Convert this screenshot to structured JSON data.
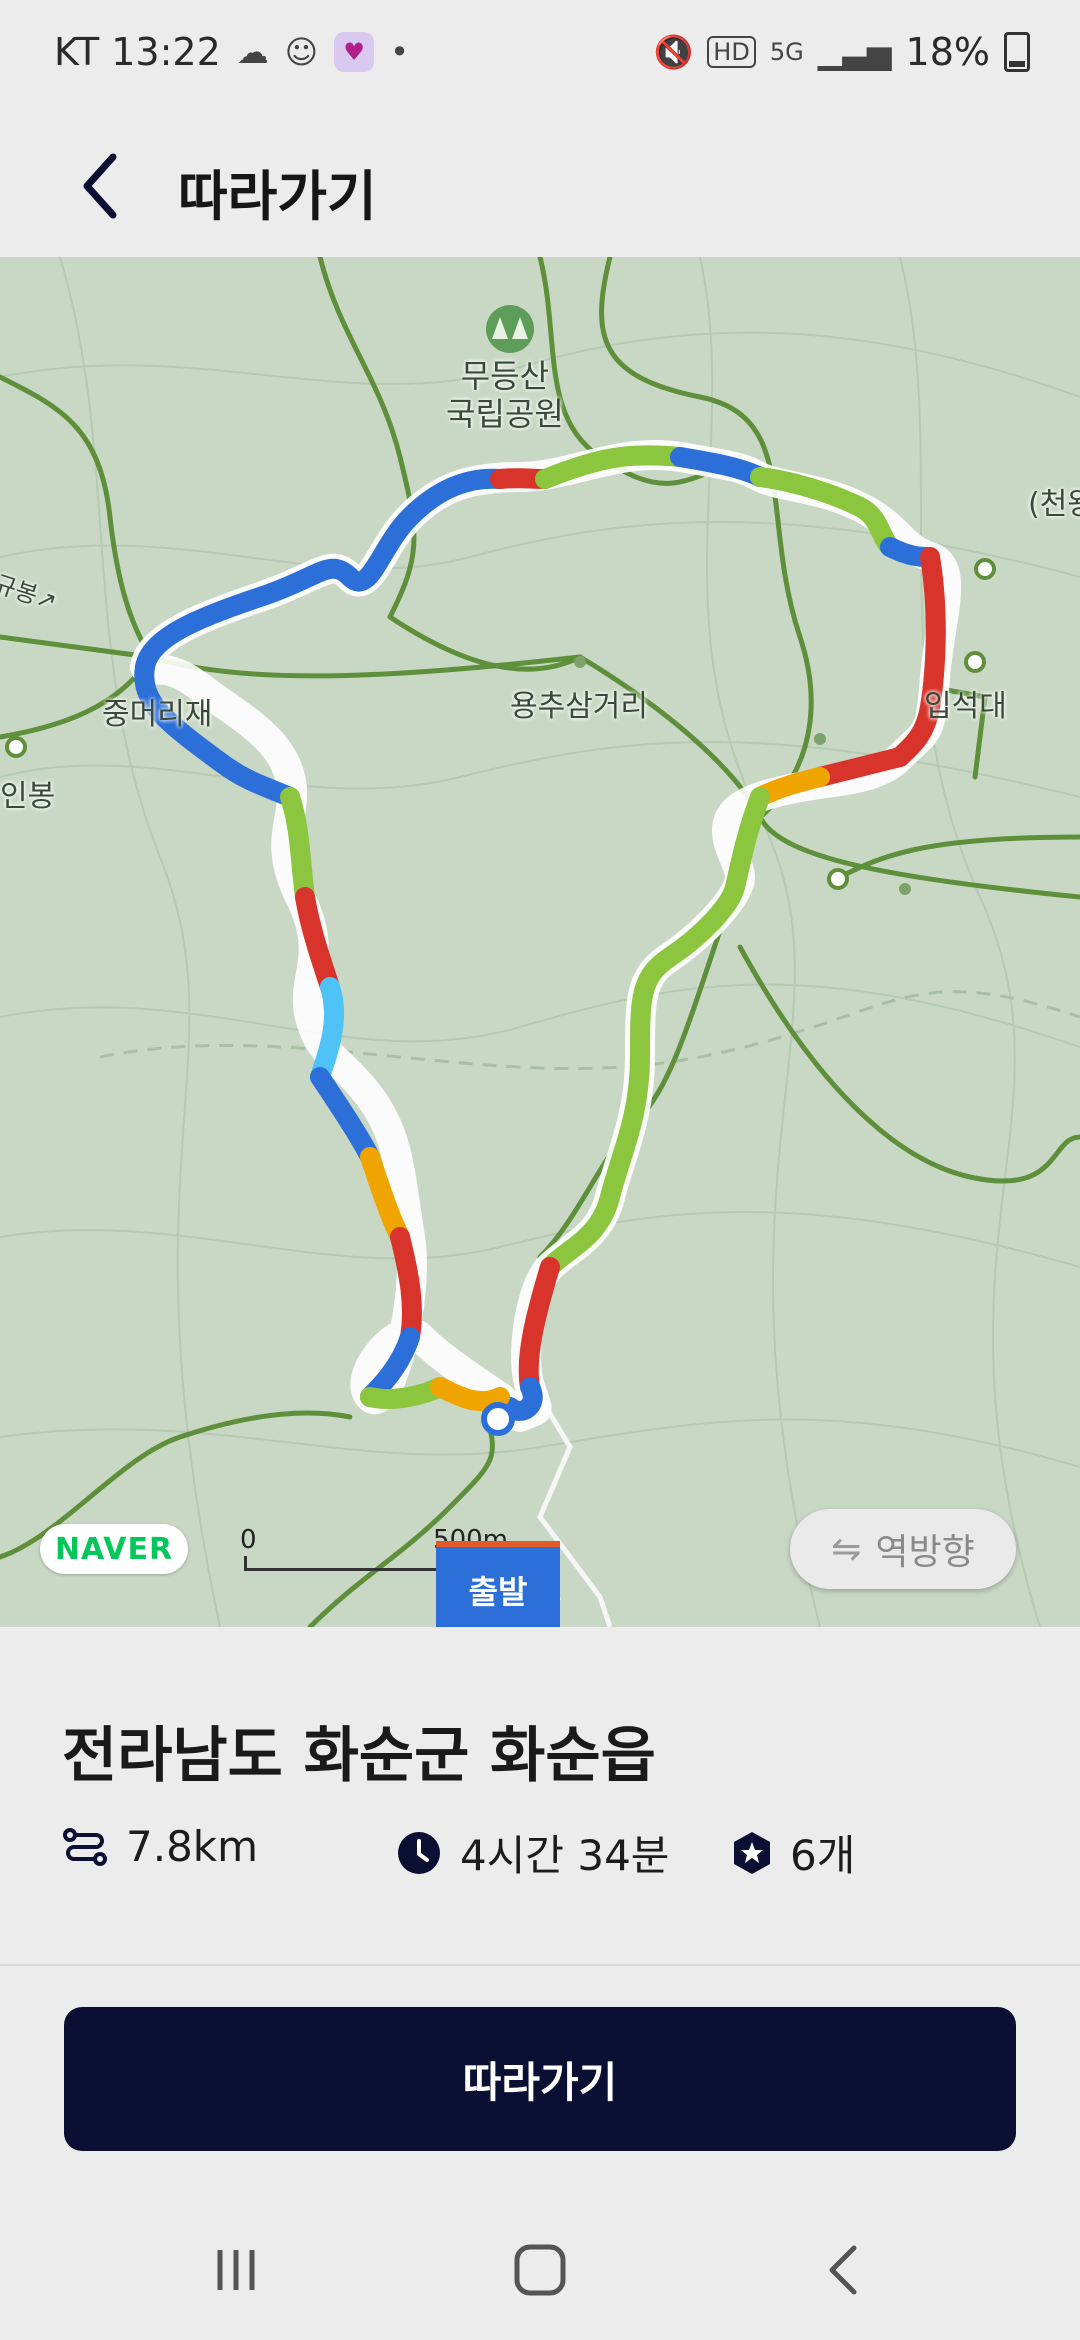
{
  "status_bar": {
    "carrier_time": "KT 13:22",
    "battery": "18%",
    "network": "5G"
  },
  "header": {
    "title": "따라가기"
  },
  "map": {
    "labels": {
      "park": "무등산\n국립공원",
      "junction": "용추삼거리",
      "pass": "중머리재",
      "peak_right": "입석대",
      "peak_left": "인봉",
      "edge_right": "(천왕",
      "edge_left": "규봉↗"
    },
    "naver_logo": "NAVER",
    "scale_start": "0",
    "scale_end": "500m",
    "reverse_label": "역방향",
    "start_marker": "출발"
  },
  "sheet": {
    "location": "전라남도 화순군 화순읍",
    "distance": "7.8km",
    "duration": "4시간 34분",
    "checkpoints": "6개",
    "follow_button": "따라가기"
  },
  "colors": {
    "button_bg": "#0a0f33",
    "naver_green": "#03c75a",
    "route_blue": "#2d6fd8",
    "route_green": "#8cc63f",
    "route_red": "#d9342b"
  }
}
